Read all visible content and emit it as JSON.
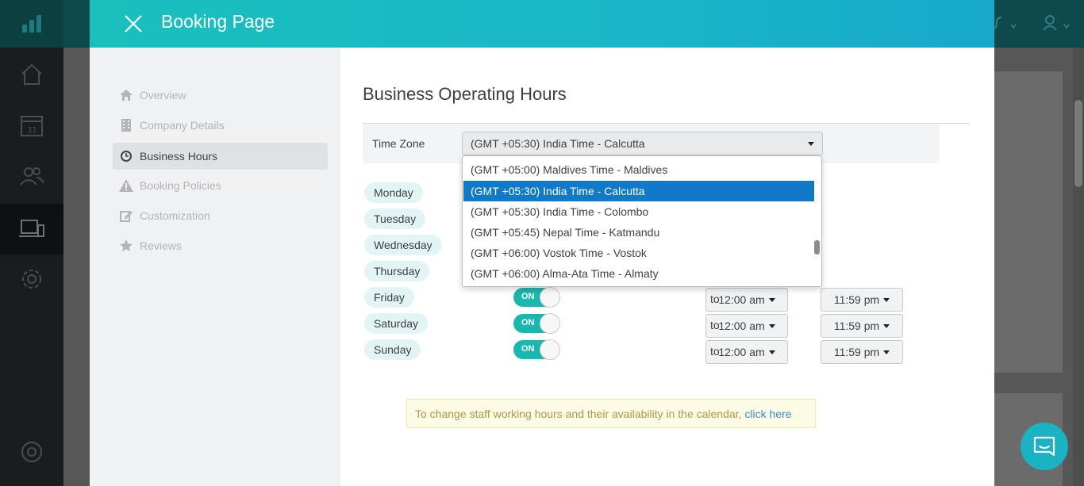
{
  "modal": {
    "title": "Booking Page"
  },
  "sidebar": {
    "items": [
      {
        "label": "Overview",
        "icon": "home-icon"
      },
      {
        "label": "Company Details",
        "icon": "building-icon"
      },
      {
        "label": "Business Hours",
        "icon": "clock-icon",
        "active": true
      },
      {
        "label": "Booking Policies",
        "icon": "warning-icon"
      },
      {
        "label": "Customization",
        "icon": "edit-icon"
      },
      {
        "label": "Reviews",
        "icon": "star-icon"
      }
    ]
  },
  "content": {
    "title": "Business Operating Hours",
    "timezone": {
      "label": "Time Zone",
      "value": "(GMT +05:30) India Time - Calcutta",
      "options": [
        "(GMT +05:00) Maldives Time - Maldives",
        "(GMT +05:30) India Time - Calcutta",
        "(GMT +05:30) India Time - Colombo",
        "(GMT +05:45) Nepal Time - Katmandu",
        "(GMT +06:00) Vostok Time - Vostok",
        "(GMT +06:00) Alma-Ata Time - Almaty"
      ],
      "selected_index": 1
    },
    "days": [
      {
        "name": "Monday"
      },
      {
        "name": "Tuesday"
      },
      {
        "name": "Wednesday"
      },
      {
        "name": "Thursday"
      },
      {
        "name": "Friday",
        "toggle": "ON",
        "from": "12:00 am",
        "to": "11:59 pm"
      },
      {
        "name": "Saturday",
        "toggle": "ON",
        "from": "12:00 am",
        "to": "11:59 pm"
      },
      {
        "name": "Sunday",
        "toggle": "ON",
        "from": "12:00 am",
        "to": "11:59 pm"
      }
    ],
    "to_word": "to",
    "notice": {
      "text": "To change staff working hours and their availability in the calendar,",
      "link": "click here"
    }
  },
  "colors": {
    "header_teal": "#19c0bd",
    "toggle_on": "#18b8b0",
    "selected_option": "#1079c8",
    "link": "#3a8ed0"
  },
  "icons": {
    "close": "close-icon",
    "chat": "chat-icon"
  }
}
